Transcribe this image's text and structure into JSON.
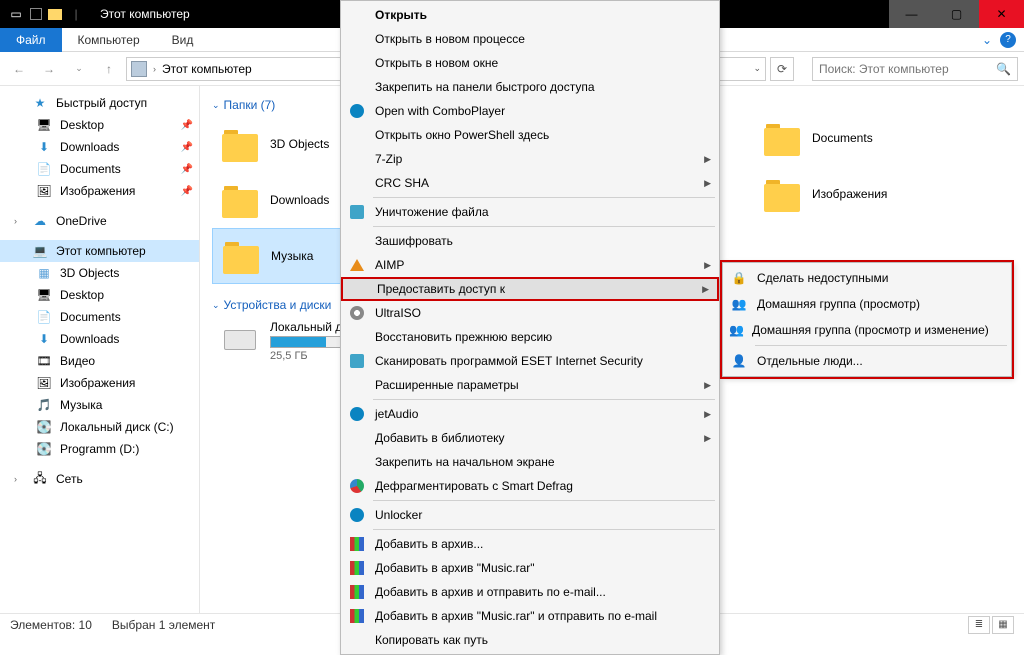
{
  "window": {
    "title": "Этот компьютер"
  },
  "ribbon": {
    "file": "Файл",
    "tabs": [
      "Компьютер",
      "Вид"
    ]
  },
  "address": {
    "path": "Этот компьютер",
    "search_placeholder": "Поиск: Этот компьютер"
  },
  "sidebar": {
    "quick_access": "Быстрый доступ",
    "quick_items": [
      {
        "label": "Desktop",
        "icon": "i-desktop",
        "pinned": true
      },
      {
        "label": "Downloads",
        "icon": "i-download",
        "pinned": true
      },
      {
        "label": "Documents",
        "icon": "i-doc",
        "pinned": true
      },
      {
        "label": "Изображения",
        "icon": "i-img",
        "pinned": true
      }
    ],
    "onedrive": "OneDrive",
    "this_pc": "Этот компьютер",
    "pc_items": [
      {
        "label": "3D Objects",
        "icon": "i-cube"
      },
      {
        "label": "Desktop",
        "icon": "i-desktop"
      },
      {
        "label": "Documents",
        "icon": "i-doc"
      },
      {
        "label": "Downloads",
        "icon": "i-download"
      },
      {
        "label": "Видео",
        "icon": "i-video"
      },
      {
        "label": "Изображения",
        "icon": "i-img"
      },
      {
        "label": "Музыка",
        "icon": "i-music"
      },
      {
        "label": "Локальный диск (C:)",
        "icon": "i-disk"
      },
      {
        "label": "Programm (D:)",
        "icon": "i-disk"
      }
    ],
    "network": "Сеть"
  },
  "content": {
    "group_folders": "Папки (7)",
    "folders": [
      {
        "label": "3D Objects"
      },
      {
        "label": "Downloads"
      },
      {
        "label": "Музыка",
        "selected": true
      },
      {
        "label": "Documents"
      },
      {
        "label": "Изображения"
      }
    ],
    "group_devices": "Устройства и диски",
    "drive": {
      "label": "Локальный диск",
      "sub": "25,5 ГБ"
    }
  },
  "context_menu": {
    "items": [
      {
        "label": "Открыть",
        "bold": true
      },
      {
        "label": "Открыть в новом процессе"
      },
      {
        "label": "Открыть в новом окне"
      },
      {
        "label": "Закрепить на панели быстрого доступа"
      },
      {
        "label": "Open with ComboPlayer",
        "icon": "circle-blue"
      },
      {
        "label": "Открыть окно PowerShell здесь"
      },
      {
        "label": "7-Zip",
        "submenu": true
      },
      {
        "label": "CRC SHA",
        "submenu": true
      },
      {
        "sep": true
      },
      {
        "label": "Уничтожение файла",
        "icon": "shield"
      },
      {
        "sep": true
      },
      {
        "label": "Зашифровать"
      },
      {
        "label": "AIMP",
        "icon": "tri-orange",
        "submenu": true
      },
      {
        "label": "Предоставить доступ к",
        "submenu": true,
        "highlighted": true
      },
      {
        "label": "UltraISO",
        "icon": "iso"
      },
      {
        "label": "Восстановить прежнюю версию"
      },
      {
        "label": "Сканировать программой ESET Internet Security",
        "icon": "shield"
      },
      {
        "label": "Расширенные параметры",
        "submenu": true
      },
      {
        "sep": true
      },
      {
        "label": "jetAudio",
        "icon": "circle-blue",
        "submenu": true
      },
      {
        "label": "Добавить в библиотеку",
        "submenu": true
      },
      {
        "label": "Закрепить на начальном экране"
      },
      {
        "label": "Дефрагментировать с Smart Defrag",
        "icon": "defrag"
      },
      {
        "sep": true
      },
      {
        "label": "Unlocker",
        "icon": "circle-blue"
      },
      {
        "sep": true
      },
      {
        "label": "Добавить в архив...",
        "icon": "books"
      },
      {
        "label": "Добавить в архив \"Music.rar\"",
        "icon": "books"
      },
      {
        "label": "Добавить в архив и отправить по e-mail...",
        "icon": "books"
      },
      {
        "label": "Добавить в архив \"Music.rar\" и отправить по e-mail",
        "icon": "books"
      },
      {
        "label": "Копировать как путь"
      }
    ]
  },
  "submenu": {
    "items": [
      {
        "label": "Сделать недоступными",
        "icon": "i-lock"
      },
      {
        "label": "Домашняя группа (просмотр)",
        "icon": "i-people"
      },
      {
        "label": "Домашняя группа (просмотр и изменение)",
        "icon": "i-people"
      },
      {
        "sep": true
      },
      {
        "label": "Отдельные люди...",
        "icon": "i-person"
      }
    ]
  },
  "statusbar": {
    "elements": "Элементов: 10",
    "selected": "Выбран 1 элемент"
  }
}
